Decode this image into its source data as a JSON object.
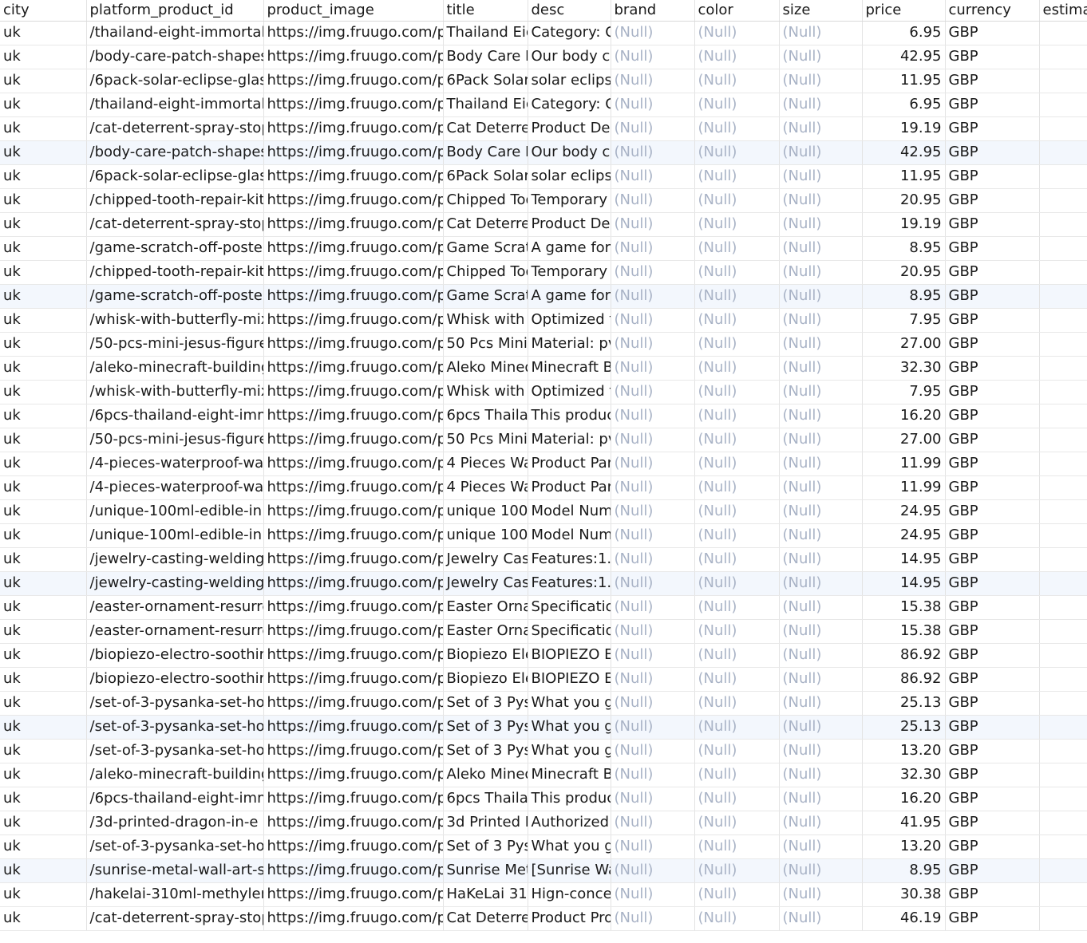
{
  "columns": [
    "city",
    "platform_product_id",
    "product_image",
    "title",
    "desc",
    "brand",
    "color",
    "size",
    "price",
    "currency",
    "estima"
  ],
  "null_text": "(Null)",
  "rows": [
    {
      "city": "uk",
      "ppid": "/thailand-eight-immortal",
      "img": "https://img.fruugo.com/p",
      "title": "Thailand Eig",
      "desc": "Category: C",
      "price": "6.95",
      "currency": "GBP"
    },
    {
      "city": "uk",
      "ppid": "/body-care-patch-shapes",
      "img": "https://img.fruugo.com/p",
      "title": "Body Care P",
      "desc": "Our body ca",
      "price": "42.95",
      "currency": "GBP"
    },
    {
      "city": "uk",
      "ppid": "/6pack-solar-eclipse-glas",
      "img": "https://img.fruugo.com/p",
      "title": "6Pack Solar",
      "desc": "solar eclipse",
      "price": "11.95",
      "currency": "GBP"
    },
    {
      "city": "uk",
      "ppid": "/thailand-eight-immortal",
      "img": "https://img.fruugo.com/p",
      "title": "Thailand Eig",
      "desc": "Category: C",
      "price": "6.95",
      "currency": "GBP"
    },
    {
      "city": "uk",
      "ppid": "/cat-deterrent-spray-stop",
      "img": "https://img.fruugo.com/p",
      "title": "Cat Deterrer",
      "desc": "Product Des",
      "price": "19.19",
      "currency": "GBP"
    },
    {
      "city": "uk",
      "ppid": "/body-care-patch-shapes",
      "img": "https://img.fruugo.com/p",
      "title": "Body Care P",
      "desc": "Our body ca",
      "price": "42.95",
      "currency": "GBP"
    },
    {
      "city": "uk",
      "ppid": "/6pack-solar-eclipse-glas",
      "img": "https://img.fruugo.com/p",
      "title": "6Pack Solar",
      "desc": "solar eclipse",
      "price": "11.95",
      "currency": "GBP"
    },
    {
      "city": "uk",
      "ppid": "/chipped-tooth-repair-kit",
      "img": "https://img.fruugo.com/p",
      "title": "Chipped Too",
      "desc": "Temporary T",
      "price": "20.95",
      "currency": "GBP"
    },
    {
      "city": "uk",
      "ppid": "/cat-deterrent-spray-stop",
      "img": "https://img.fruugo.com/p",
      "title": "Cat Deterrer",
      "desc": "Product Des",
      "price": "19.19",
      "currency": "GBP"
    },
    {
      "city": "uk",
      "ppid": "/game-scratch-off-poster",
      "img": "https://img.fruugo.com/p",
      "title": "Game Scratc",
      "desc": "A game for",
      "price": "8.95",
      "currency": "GBP"
    },
    {
      "city": "uk",
      "ppid": "/chipped-tooth-repair-kit",
      "img": "https://img.fruugo.com/p",
      "title": "Chipped Too",
      "desc": "Temporary T",
      "price": "20.95",
      "currency": "GBP"
    },
    {
      "city": "uk",
      "ppid": "/game-scratch-off-poster",
      "img": "https://img.fruugo.com/p",
      "title": "Game Scratc",
      "desc": "A game for",
      "price": "8.95",
      "currency": "GBP"
    },
    {
      "city": "uk",
      "ppid": "/whisk-with-butterfly-mix",
      "img": "https://img.fruugo.com/p",
      "title": "Whisk with B",
      "desc": "Optimized f",
      "price": "7.95",
      "currency": "GBP"
    },
    {
      "city": "uk",
      "ppid": "/50-pcs-mini-jesus-figure",
      "img": "https://img.fruugo.com/p",
      "title": "50 Pcs Mini",
      "desc": "Material: pv",
      "price": "27.00",
      "currency": "GBP"
    },
    {
      "city": "uk",
      "ppid": "/aleko-minecraft-building",
      "img": "https://img.fruugo.com/p",
      "title": "Aleko Mined",
      "desc": "Minecraft Bu",
      "price": "32.30",
      "currency": "GBP"
    },
    {
      "city": "uk",
      "ppid": "/whisk-with-butterfly-mix",
      "img": "https://img.fruugo.com/p",
      "title": "Whisk with B",
      "desc": "Optimized f",
      "price": "7.95",
      "currency": "GBP"
    },
    {
      "city": "uk",
      "ppid": "/6pcs-thailand-eight-imm",
      "img": "https://img.fruugo.com/p",
      "title": "6pcs Thailar",
      "desc": "This produc",
      "price": "16.20",
      "currency": "GBP"
    },
    {
      "city": "uk",
      "ppid": "/50-pcs-mini-jesus-figure",
      "img": "https://img.fruugo.com/p",
      "title": "50 Pcs Mini",
      "desc": "Material: pv",
      "price": "27.00",
      "currency": "GBP"
    },
    {
      "city": "uk",
      "ppid": "/4-pieces-waterproof-wa",
      "img": "https://img.fruugo.com/p",
      "title": "4 Pieces Wa",
      "desc": "Product Par",
      "price": "11.99",
      "currency": "GBP"
    },
    {
      "city": "uk",
      "ppid": "/4-pieces-waterproof-wa",
      "img": "https://img.fruugo.com/p",
      "title": "4 Pieces Wa",
      "desc": "Product Par",
      "price": "11.99",
      "currency": "GBP"
    },
    {
      "city": "uk",
      "ppid": "/unique-100ml-edible-in",
      "img": "https://img.fruugo.com/p",
      "title": "unique 100l",
      "desc": "Model Num",
      "price": "24.95",
      "currency": "GBP"
    },
    {
      "city": "uk",
      "ppid": "/unique-100ml-edible-in",
      "img": "https://img.fruugo.com/p",
      "title": "unique 100l",
      "desc": "Model Num",
      "price": "24.95",
      "currency": "GBP"
    },
    {
      "city": "uk",
      "ppid": "/jewelry-casting-welding",
      "img": "https://img.fruugo.com/p",
      "title": "Jewelry Cast",
      "desc": "Features:1. E",
      "price": "14.95",
      "currency": "GBP"
    },
    {
      "city": "uk",
      "ppid": "/jewelry-casting-welding",
      "img": "https://img.fruugo.com/p",
      "title": "Jewelry Cast",
      "desc": "Features:1. E",
      "price": "14.95",
      "currency": "GBP"
    },
    {
      "city": "uk",
      "ppid": "/easter-ornament-resurre",
      "img": "https://img.fruugo.com/p",
      "title": "Easter Orna",
      "desc": "Specificatio",
      "price": "15.38",
      "currency": "GBP"
    },
    {
      "city": "uk",
      "ppid": "/easter-ornament-resurre",
      "img": "https://img.fruugo.com/p",
      "title": "Easter Orna",
      "desc": "Specificatio",
      "price": "15.38",
      "currency": "GBP"
    },
    {
      "city": "uk",
      "ppid": "/biopiezo-electro-soothir",
      "img": "https://img.fruugo.com/p",
      "title": "Biopiezo Ele",
      "desc": "BIOPIEZO EL",
      "price": "86.92",
      "currency": "GBP"
    },
    {
      "city": "uk",
      "ppid": "/biopiezo-electro-soothir",
      "img": "https://img.fruugo.com/p",
      "title": "Biopiezo Ele",
      "desc": "BIOPIEZO EL",
      "price": "86.92",
      "currency": "GBP"
    },
    {
      "city": "uk",
      "ppid": "/set-of-3-pysanka-set-ho",
      "img": "https://img.fruugo.com/p",
      "title": "Set of 3 Pysa",
      "desc": "What you ge",
      "price": "25.13",
      "currency": "GBP"
    },
    {
      "city": "uk",
      "ppid": "/set-of-3-pysanka-set-ho",
      "img": "https://img.fruugo.com/p",
      "title": "Set of 3 Pysa",
      "desc": "What you ge",
      "price": "25.13",
      "currency": "GBP"
    },
    {
      "city": "uk",
      "ppid": "/set-of-3-pysanka-set-ho",
      "img": "https://img.fruugo.com/p",
      "title": "Set of 3 Pysa",
      "desc": "What you ge",
      "price": "13.20",
      "currency": "GBP"
    },
    {
      "city": "uk",
      "ppid": "/aleko-minecraft-building",
      "img": "https://img.fruugo.com/p",
      "title": "Aleko Mined",
      "desc": "Minecraft Bu",
      "price": "32.30",
      "currency": "GBP"
    },
    {
      "city": "uk",
      "ppid": "/6pcs-thailand-eight-imm",
      "img": "https://img.fruugo.com/p",
      "title": "6pcs Thailar",
      "desc": "This produc",
      "price": "16.20",
      "currency": "GBP"
    },
    {
      "city": "uk",
      "ppid": "/3d-printed-dragon-in-e",
      "img": "https://img.fruugo.com/p",
      "title": "3d Printed D",
      "desc": "Authorized",
      "price": "41.95",
      "currency": "GBP"
    },
    {
      "city": "uk",
      "ppid": "/set-of-3-pysanka-set-ho",
      "img": "https://img.fruugo.com/p",
      "title": "Set of 3 Pysa",
      "desc": "What you ge",
      "price": "13.20",
      "currency": "GBP"
    },
    {
      "city": "uk",
      "ppid": "/sunrise-metal-wall-art-su",
      "img": "https://img.fruugo.com/p",
      "title": "Sunrise Met",
      "desc": "[Sunrise Wa",
      "price": "8.95",
      "currency": "GBP"
    },
    {
      "city": "uk",
      "ppid": "/hakelai-310ml-methylen",
      "img": "https://img.fruugo.com/p",
      "title": "HaKeLai 310",
      "desc": "Hign-conce",
      "price": "30.38",
      "currency": "GBP"
    },
    {
      "city": "uk",
      "ppid": "/cat-deterrent-spray-stop",
      "img": "https://img.fruugo.com/p",
      "title": "Cat Deterrer",
      "desc": "Product Pro",
      "price": "46.19",
      "currency": "GBP"
    }
  ],
  "highlighted_rows": [
    5,
    11,
    23,
    29,
    35
  ],
  "colors": {
    "null_text": "#a9b3c6",
    "highlight_row": "#f3f7fd",
    "grid_line": "#e3e3e3"
  }
}
